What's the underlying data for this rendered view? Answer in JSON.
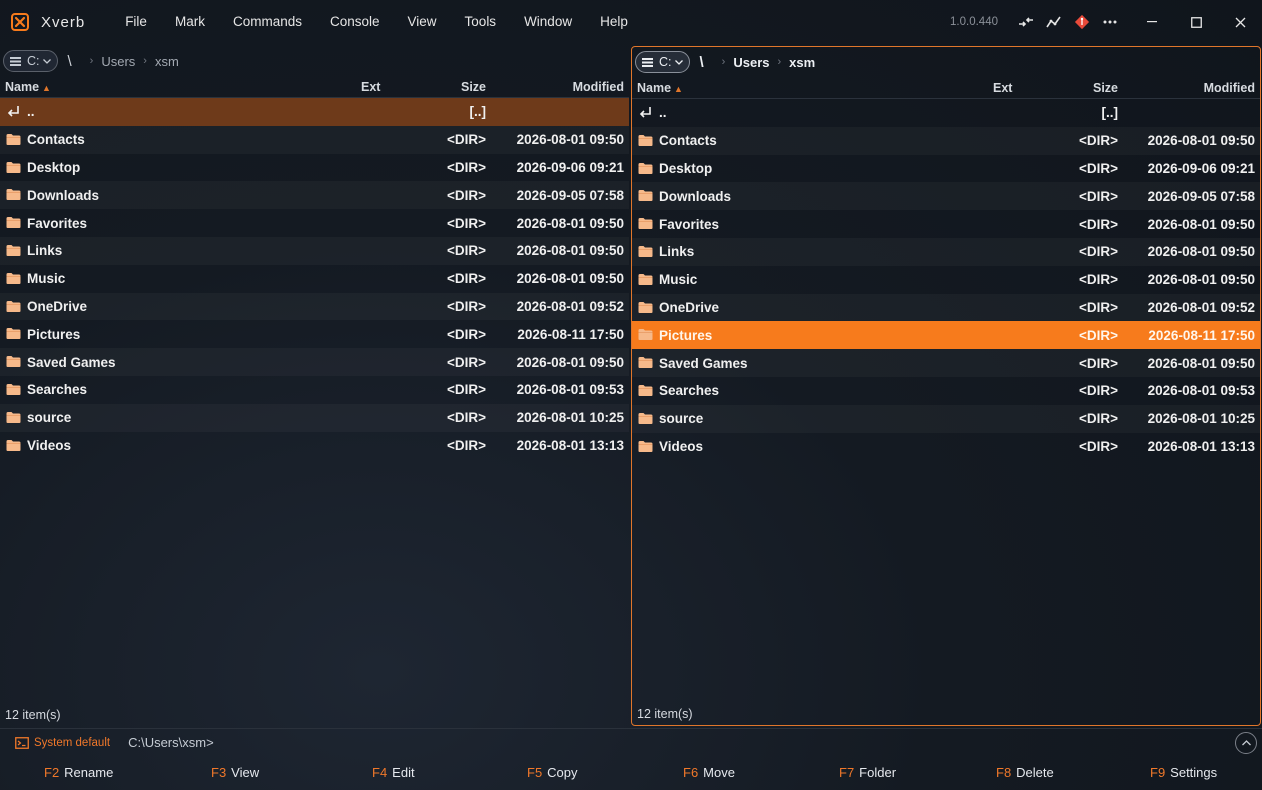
{
  "app": {
    "name": "Xverb",
    "version": "1.0.0.440"
  },
  "menu": [
    "File",
    "Mark",
    "Commands",
    "Console",
    "View",
    "Tools",
    "Window",
    "Help"
  ],
  "toolbar_icons": [
    "compare-icon",
    "activity-icon",
    "git-icon",
    "more-icon"
  ],
  "colors": {
    "accent": "#f77b1c",
    "inactive_cursor": "#6e3a1a",
    "border_active": "#e0762b"
  },
  "columns": {
    "name": "Name",
    "ext": "Ext",
    "size": "Size",
    "modified": "Modified"
  },
  "left_panel": {
    "drive": "C:",
    "root": "\\",
    "crumbs": [
      "Users",
      "xsm"
    ],
    "parent": {
      "name": "..",
      "size": "[..]"
    },
    "rows": [
      {
        "name": "Contacts",
        "size": "<DIR>",
        "modified": "2026-08-01 09:50"
      },
      {
        "name": "Desktop",
        "size": "<DIR>",
        "modified": "2026-09-06 09:21"
      },
      {
        "name": "Downloads",
        "size": "<DIR>",
        "modified": "2026-09-05 07:58"
      },
      {
        "name": "Favorites",
        "size": "<DIR>",
        "modified": "2026-08-01 09:50"
      },
      {
        "name": "Links",
        "size": "<DIR>",
        "modified": "2026-08-01 09:50"
      },
      {
        "name": "Music",
        "size": "<DIR>",
        "modified": "2026-08-01 09:50"
      },
      {
        "name": "OneDrive",
        "size": "<DIR>",
        "modified": "2026-08-01 09:52"
      },
      {
        "name": "Pictures",
        "size": "<DIR>",
        "modified": "2026-08-11 17:50"
      },
      {
        "name": "Saved Games",
        "size": "<DIR>",
        "modified": "2026-08-01 09:50"
      },
      {
        "name": "Searches",
        "size": "<DIR>",
        "modified": "2026-08-01 09:53"
      },
      {
        "name": "source",
        "size": "<DIR>",
        "modified": "2026-08-01 10:25"
      },
      {
        "name": "Videos",
        "size": "<DIR>",
        "modified": "2026-08-01 13:13"
      }
    ],
    "status": "12 item(s)"
  },
  "right_panel": {
    "drive": "C:",
    "root": "\\",
    "crumbs": [
      "Users",
      "xsm"
    ],
    "parent": {
      "name": "..",
      "size": "[..]"
    },
    "rows": [
      {
        "name": "Contacts",
        "size": "<DIR>",
        "modified": "2026-08-01 09:50"
      },
      {
        "name": "Desktop",
        "size": "<DIR>",
        "modified": "2026-09-06 09:21"
      },
      {
        "name": "Downloads",
        "size": "<DIR>",
        "modified": "2026-09-05 07:58"
      },
      {
        "name": "Favorites",
        "size": "<DIR>",
        "modified": "2026-08-01 09:50"
      },
      {
        "name": "Links",
        "size": "<DIR>",
        "modified": "2026-08-01 09:50"
      },
      {
        "name": "Music",
        "size": "<DIR>",
        "modified": "2026-08-01 09:50"
      },
      {
        "name": "OneDrive",
        "size": "<DIR>",
        "modified": "2026-08-01 09:52"
      },
      {
        "name": "Pictures",
        "size": "<DIR>",
        "modified": "2026-08-11 17:50",
        "selected": true
      },
      {
        "name": "Saved Games",
        "size": "<DIR>",
        "modified": "2026-08-01 09:50"
      },
      {
        "name": "Searches",
        "size": "<DIR>",
        "modified": "2026-08-01 09:53"
      },
      {
        "name": "source",
        "size": "<DIR>",
        "modified": "2026-08-01 10:25"
      },
      {
        "name": "Videos",
        "size": "<DIR>",
        "modified": "2026-08-01 13:13"
      }
    ],
    "status": "12 item(s)"
  },
  "console": {
    "shell_label": "System default",
    "prompt": "C:\\Users\\xsm>"
  },
  "fkeys": [
    {
      "key": "F2",
      "label": "Rename"
    },
    {
      "key": "F3",
      "label": "View"
    },
    {
      "key": "F4",
      "label": "Edit"
    },
    {
      "key": "F5",
      "label": "Copy"
    },
    {
      "key": "F6",
      "label": "Move"
    },
    {
      "key": "F7",
      "label": "Folder"
    },
    {
      "key": "F8",
      "label": "Delete"
    },
    {
      "key": "F9",
      "label": "Settings"
    }
  ]
}
